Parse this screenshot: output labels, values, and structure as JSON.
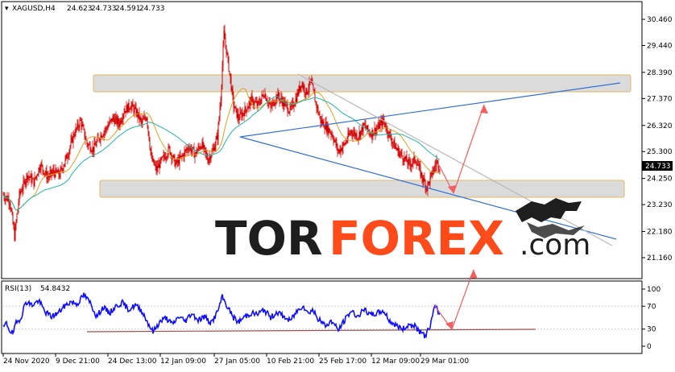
{
  "colors": {
    "candle": "#d10000",
    "ma_fast": "#e0a020",
    "ma_slow": "#20b8a8",
    "trendline": "#2f6fd6",
    "trendline_grey": "#b8b8b8",
    "zone_fill": "#d9d9d9",
    "zone_border": "#e7b660",
    "arrow": "#f06060",
    "rsi_line": "#1010ff",
    "rsi_support": "#a05050",
    "logo_dark": "#1e1e1e",
    "logo_red": "#ff4a1a",
    "price_tag_bg": "#000000"
  },
  "chart_data": [
    {
      "type": "candlestick",
      "title": "XAGUSD,H4",
      "header_values": [
        "24.623",
        "24.733",
        "24.591",
        "24.733"
      ],
      "current_price": "24.733",
      "y_ticks": [
        "30.460",
        "29.440",
        "28.390",
        "27.370",
        "26.320",
        "25.300",
        "24.250",
        "23.230",
        "22.180",
        "21.160"
      ],
      "ylim": [
        21.16,
        30.46
      ],
      "x_ticks": [
        "24 Nov 2020",
        "9 Dec 21:00",
        "24 Dec 13:00",
        "12 Jan 09:00",
        "27 Jan 05:00",
        "10 Feb 21:00",
        "25 Feb 17:00",
        "12 Mar 09:00",
        "29 Mar 01:00"
      ],
      "x_tick_index": [
        0,
        65,
        130,
        195,
        262,
        327,
        392,
        457,
        518
      ],
      "close_anchors": [
        [
          0,
          23.6
        ],
        [
          8,
          23.4
        ],
        [
          14,
          22.0
        ],
        [
          20,
          23.6
        ],
        [
          30,
          24.4
        ],
        [
          38,
          24.1
        ],
        [
          46,
          24.8
        ],
        [
          55,
          24.3
        ],
        [
          62,
          24.5
        ],
        [
          70,
          24.4
        ],
        [
          80,
          25.2
        ],
        [
          88,
          26.0
        ],
        [
          96,
          26.5
        ],
        [
          104,
          25.6
        ],
        [
          112,
          25.4
        ],
        [
          120,
          25.9
        ],
        [
          128,
          26.2
        ],
        [
          136,
          26.6
        ],
        [
          144,
          26.4
        ],
        [
          150,
          26.9
        ],
        [
          158,
          27.1
        ],
        [
          166,
          26.8
        ],
        [
          172,
          26.4
        ],
        [
          178,
          26.7
        ],
        [
          184,
          25.0
        ],
        [
          190,
          24.6
        ],
        [
          198,
          25.0
        ],
        [
          206,
          25.4
        ],
        [
          214,
          24.8
        ],
        [
          222,
          25.1
        ],
        [
          230,
          25.5
        ],
        [
          238,
          25.2
        ],
        [
          246,
          25.6
        ],
        [
          254,
          25.0
        ],
        [
          260,
          25.3
        ],
        [
          266,
          25.9
        ],
        [
          270,
          27.4
        ],
        [
          274,
          29.9
        ],
        [
          280,
          28.6
        ],
        [
          286,
          27.1
        ],
        [
          292,
          26.6
        ],
        [
          300,
          26.9
        ],
        [
          308,
          27.3
        ],
        [
          316,
          27.1
        ],
        [
          324,
          27.6
        ],
        [
          332,
          27.0
        ],
        [
          340,
          27.5
        ],
        [
          348,
          27.2
        ],
        [
          356,
          26.9
        ],
        [
          364,
          27.4
        ],
        [
          370,
          28.0
        ],
        [
          376,
          27.6
        ],
        [
          382,
          28.0
        ],
        [
          388,
          27.2
        ],
        [
          394,
          26.5
        ],
        [
          400,
          26.3
        ],
        [
          408,
          26.0
        ],
        [
          416,
          25.3
        ],
        [
          424,
          25.6
        ],
        [
          432,
          26.1
        ],
        [
          440,
          25.9
        ],
        [
          448,
          26.3
        ],
        [
          456,
          26.0
        ],
        [
          464,
          26.2
        ],
        [
          472,
          26.5
        ],
        [
          480,
          25.9
        ],
        [
          488,
          25.4
        ],
        [
          496,
          25.1
        ],
        [
          504,
          24.8
        ],
        [
          512,
          25.0
        ],
        [
          520,
          24.3
        ],
        [
          526,
          23.9
        ],
        [
          532,
          24.4
        ],
        [
          538,
          24.9
        ],
        [
          542,
          24.733
        ]
      ]
    },
    {
      "type": "line",
      "title": "RSI(13)",
      "header_value": "54.8432",
      "y_ticks": [
        "100",
        "70",
        "30",
        "0"
      ],
      "ylim": [
        0,
        100
      ],
      "levels": [
        70,
        30
      ],
      "values_anchors": [
        [
          0,
          32
        ],
        [
          4,
          40
        ],
        [
          8,
          28
        ],
        [
          12,
          22
        ],
        [
          16,
          40
        ],
        [
          22,
          50
        ],
        [
          28,
          78
        ],
        [
          36,
          72
        ],
        [
          44,
          80
        ],
        [
          52,
          60
        ],
        [
          60,
          52
        ],
        [
          68,
          58
        ],
        [
          76,
          70
        ],
        [
          84,
          78
        ],
        [
          92,
          74
        ],
        [
          100,
          90
        ],
        [
          108,
          76
        ],
        [
          116,
          52
        ],
        [
          124,
          68
        ],
        [
          132,
          58
        ],
        [
          140,
          70
        ],
        [
          148,
          76
        ],
        [
          156,
          64
        ],
        [
          164,
          72
        ],
        [
          172,
          62
        ],
        [
          180,
          40
        ],
        [
          186,
          25
        ],
        [
          194,
          42
        ],
        [
          202,
          50
        ],
        [
          210,
          38
        ],
        [
          218,
          52
        ],
        [
          226,
          44
        ],
        [
          234,
          58
        ],
        [
          242,
          46
        ],
        [
          250,
          52
        ],
        [
          258,
          40
        ],
        [
          266,
          60
        ],
        [
          272,
          86
        ],
        [
          278,
          70
        ],
        [
          286,
          50
        ],
        [
          292,
          42
        ],
        [
          300,
          52
        ],
        [
          308,
          58
        ],
        [
          316,
          56
        ],
        [
          324,
          64
        ],
        [
          332,
          50
        ],
        [
          340,
          60
        ],
        [
          348,
          52
        ],
        [
          356,
          44
        ],
        [
          364,
          60
        ],
        [
          372,
          72
        ],
        [
          378,
          58
        ],
        [
          384,
          64
        ],
        [
          392,
          46
        ],
        [
          400,
          36
        ],
        [
          408,
          44
        ],
        [
          416,
          28
        ],
        [
          424,
          46
        ],
        [
          432,
          62
        ],
        [
          440,
          52
        ],
        [
          448,
          64
        ],
        [
          456,
          54
        ],
        [
          464,
          58
        ],
        [
          472,
          62
        ],
        [
          480,
          44
        ],
        [
          488,
          36
        ],
        [
          496,
          30
        ],
        [
          504,
          38
        ],
        [
          512,
          34
        ],
        [
          518,
          24
        ],
        [
          524,
          18
        ],
        [
          530,
          36
        ],
        [
          536,
          70
        ],
        [
          542,
          55
        ]
      ]
    }
  ],
  "logo": {
    "part1": "TOR",
    "part2": "FOREX",
    "part3": ".com"
  }
}
